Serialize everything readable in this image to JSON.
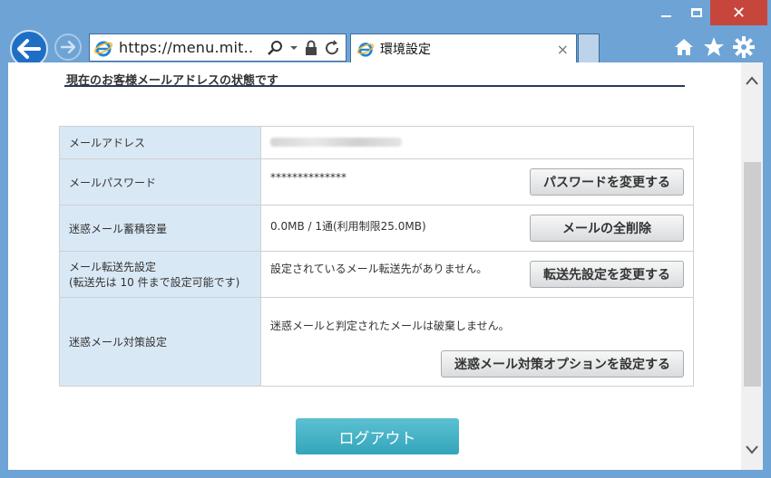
{
  "browser": {
    "address": "https://menu.mit...",
    "tab_title": "環境設定",
    "tab_close": "×",
    "win_close": "✕"
  },
  "page": {
    "section_heading": "現在のお客様メールアドレスの状態です",
    "rows": [
      {
        "label": "メールアドレス",
        "value": ""
      },
      {
        "label": "メールパスワード",
        "value": "**************",
        "button": "パスワードを変更する"
      },
      {
        "label": "迷惑メール蓄積容量",
        "value": "0.0MB / 1通(利用制限25.0MB)",
        "button": "メールの全削除"
      },
      {
        "label_line1": "メール転送先設定",
        "label_line2": "(転送先は 10 件まで設定可能です)",
        "value": "設定されているメール転送先がありません。",
        "button": "転送先設定を変更する"
      },
      {
        "label": "迷惑メール対策設定",
        "value": "迷惑メールと判定されたメールは破棄しません。",
        "button": "迷惑メール対策オプションを設定する"
      }
    ],
    "logout_label": "ログアウト"
  },
  "icons": {
    "accent": "#1e6fc4",
    "chrome": "#6ea3d6",
    "logout_color": "#3fb0c4"
  }
}
